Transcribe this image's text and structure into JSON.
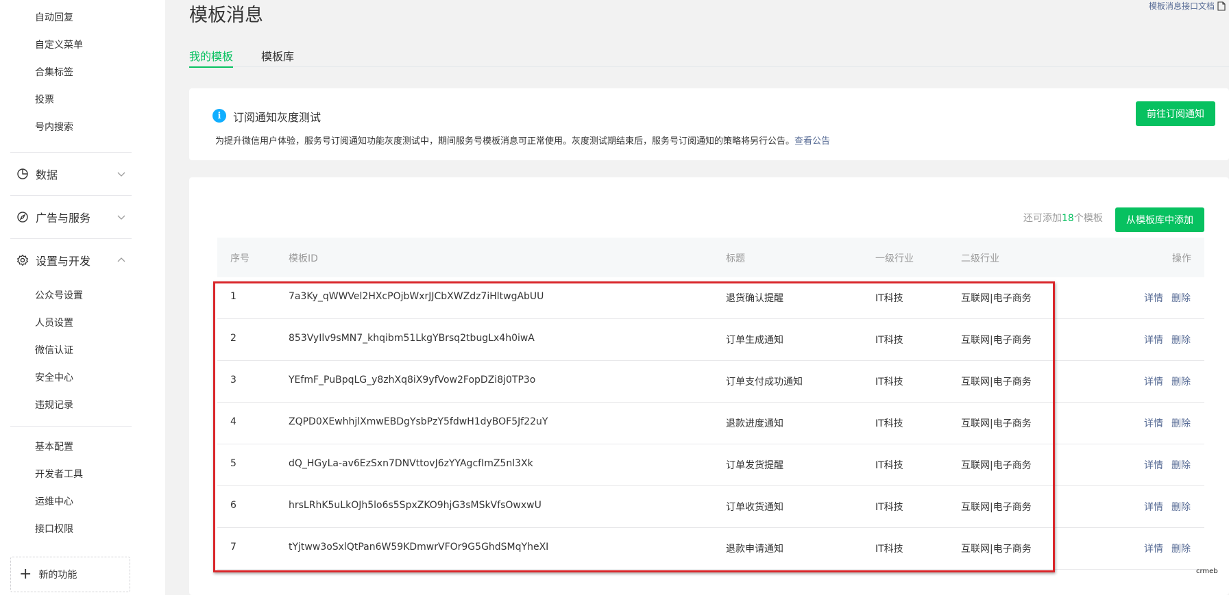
{
  "sidebar": {
    "top_items": [
      {
        "label": "自动回复"
      },
      {
        "label": "自定义菜单"
      },
      {
        "label": "合集标签"
      },
      {
        "label": "投票"
      },
      {
        "label": "号内搜索"
      }
    ],
    "sections": {
      "data": {
        "label": "数据",
        "icon": "chart-pie-icon",
        "state": "collapsed"
      },
      "ads": {
        "label": "广告与服务",
        "icon": "compass-icon",
        "state": "collapsed"
      },
      "settings": {
        "label": "设置与开发",
        "icon": "gear-icon",
        "state": "expanded"
      }
    },
    "settings_items": [
      {
        "label": "公众号设置"
      },
      {
        "label": "人员设置"
      },
      {
        "label": "微信认证"
      },
      {
        "label": "安全中心"
      },
      {
        "label": "违规记录"
      }
    ],
    "dev_items": [
      {
        "label": "基本配置"
      },
      {
        "label": "开发者工具"
      },
      {
        "label": "运维中心"
      },
      {
        "label": "接口权限"
      }
    ],
    "new_feature_label": "新的功能"
  },
  "header": {
    "title": "模板消息",
    "doc_link": "模板消息接口文档"
  },
  "tabs": [
    {
      "label": "我的模板",
      "active": true
    },
    {
      "label": "模板库",
      "active": false
    }
  ],
  "notice": {
    "title": "订阅通知灰度测试",
    "text": "为提升微信用户体验，服务号订阅通知功能灰度测试中，期间服务号模板消息可正常使用。灰度测试期结束后，服务号订阅通知的策略将另行公告。",
    "link": "查看公告",
    "button": "前往订阅通知"
  },
  "list": {
    "remain_prefix": "还可添加",
    "remain_count": "18",
    "remain_suffix": "个模板",
    "add_button": "从模板库中添加",
    "columns": [
      "序号",
      "模板ID",
      "标题",
      "一级行业",
      "二级行业",
      "操作"
    ],
    "rows": [
      {
        "no": "1",
        "id": "7a3Ky_qWWVel2HXcPOjbWxrJJCbXWZdz7iHltwgAbUU",
        "title": "退货确认提醒",
        "industry1": "IT科技",
        "industry2": "互联网|电子商务",
        "detail": "详情",
        "delete": "删除"
      },
      {
        "no": "2",
        "id": "853VyIlv9sMN7_khqibm51LkgYBrsq2tbugLx4h0iwA",
        "title": "订单生成通知",
        "industry1": "IT科技",
        "industry2": "互联网|电子商务",
        "detail": "详情",
        "delete": "删除"
      },
      {
        "no": "3",
        "id": "YEfmF_PuBpqLG_y8zhXq8iX9yfVow2FopDZi8j0TP3o",
        "title": "订单支付成功通知",
        "industry1": "IT科技",
        "industry2": "互联网|电子商务",
        "detail": "详情",
        "delete": "删除"
      },
      {
        "no": "4",
        "id": "ZQPD0XEwhhjlXmwEBDgYsbPzY5fdwH1dyBOF5Jf22uY",
        "title": "退款进度通知",
        "industry1": "IT科技",
        "industry2": "互联网|电子商务",
        "detail": "详情",
        "delete": "删除"
      },
      {
        "no": "5",
        "id": "dQ_HGyLa-av6EzSxn7DNVttovJ6zYYAgcfImZ5nl3Xk",
        "title": "订单发货提醒",
        "industry1": "IT科技",
        "industry2": "互联网|电子商务",
        "detail": "详情",
        "delete": "删除"
      },
      {
        "no": "6",
        "id": "hrsLRhK5uLkOJh5lo6s5SpxZKO9hjG3sMSkVfsOwxwU",
        "title": "订单收货通知",
        "industry1": "IT科技",
        "industry2": "互联网|电子商务",
        "detail": "详情",
        "delete": "删除"
      },
      {
        "no": "7",
        "id": "tYjtww3oSxlQtPan6W59KDmwrVFOr9G5GhdSMqYheXI",
        "title": "退款申请通知",
        "industry1": "IT科技",
        "industry2": "互联网|电子商务",
        "detail": "详情",
        "delete": "删除"
      }
    ]
  },
  "watermark": "crmeb",
  "colors": {
    "accent_green": "#07c160",
    "link_blue": "#576b95",
    "info_blue": "#10aeff",
    "highlight_red": "#d9262a"
  }
}
